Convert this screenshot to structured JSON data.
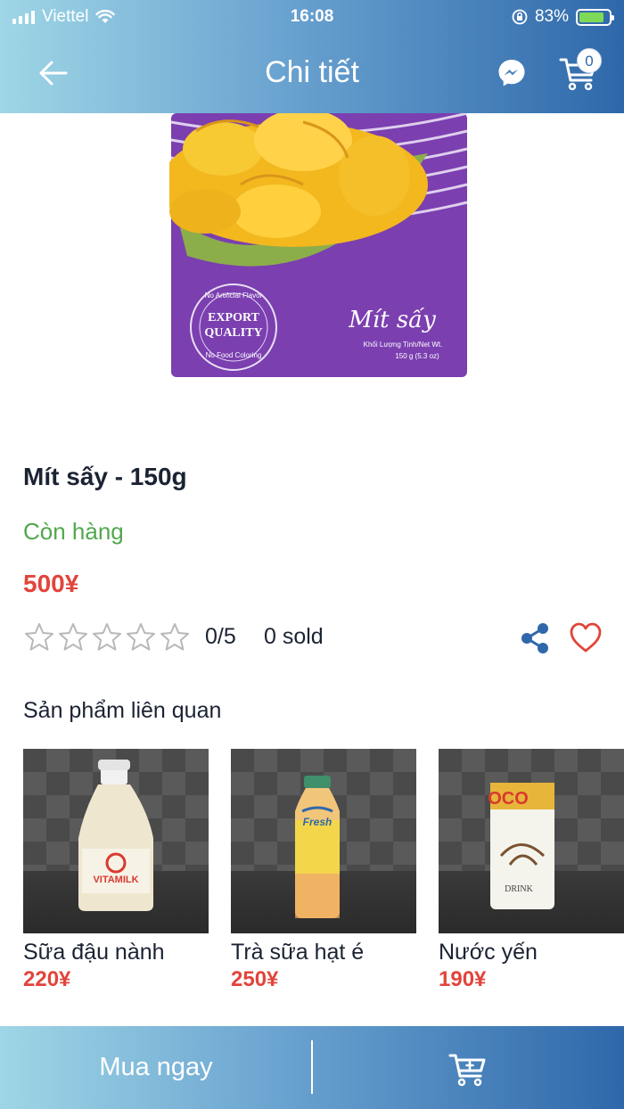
{
  "status_bar": {
    "carrier": "Viettel",
    "time": "16:08",
    "battery": "83%"
  },
  "header": {
    "title": "Chi tiết",
    "cart_count": "0"
  },
  "product": {
    "image_title": "Mít sấy",
    "image_badge_line1": "EXPORT",
    "image_badge_line2": "QUALITY",
    "image_badge_top": "No Artificial Flavor",
    "image_badge_bottom": "No Food Coloring",
    "image_weight_label": "Khối Lượng Tịnh/Net Wt.",
    "image_weight": "150 g (5.3 oz)",
    "name": "Mít sấy - 150g",
    "stock": "Còn hàng",
    "price": "500¥",
    "rating": "0/5",
    "rating_value": 0,
    "rating_max": 5,
    "sold": "0 sold"
  },
  "related": {
    "title": "Sản phẩm liên quan",
    "items": [
      {
        "name": "Sữa đậu nành",
        "price": "220¥",
        "label": "VITAMILK"
      },
      {
        "name": "Trà sữa hạt é",
        "price": "250¥",
        "label": "Fresh"
      },
      {
        "name": "Nước yến",
        "price": "190¥",
        "label": "OCO",
        "label2": "DRINK"
      }
    ]
  },
  "bottom": {
    "buy_now": "Mua ngay"
  }
}
